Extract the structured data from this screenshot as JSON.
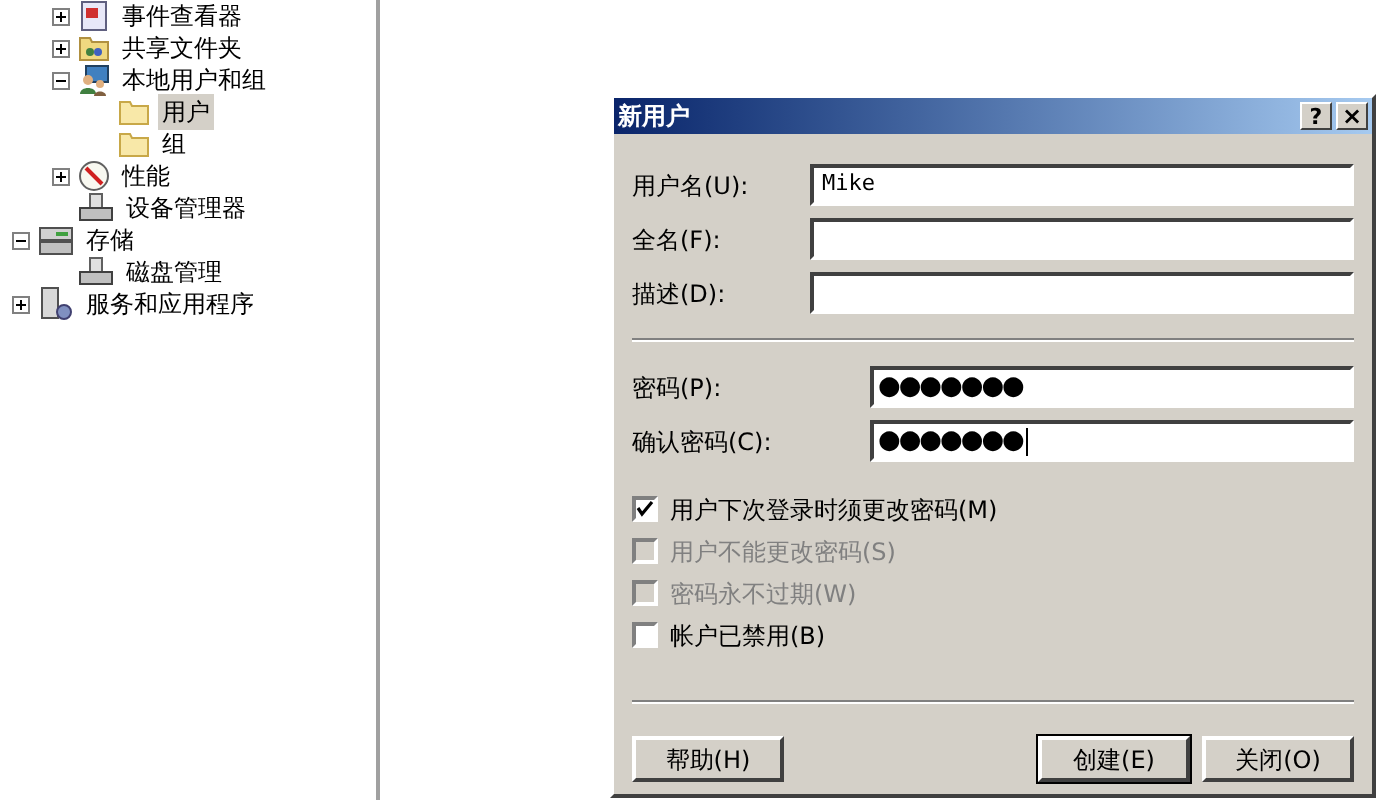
{
  "tree": [
    {
      "children": [
        {
          "label": "事件查看器",
          "expanded": false,
          "kind": "viewer"
        },
        {
          "label": "共享文件夹",
          "expanded": false,
          "kind": "share"
        },
        {
          "label": "本地用户和组",
          "expanded": true,
          "kind": "users",
          "children": [
            {
              "label": "用户",
              "kind": "folder",
              "selected": true
            },
            {
              "label": "组",
              "kind": "folder",
              "selected": false
            }
          ]
        },
        {
          "label": "性能",
          "expanded": false,
          "kind": "perf"
        },
        {
          "label": "设备管理器",
          "kind": "device"
        }
      ]
    },
    {
      "label": "存储",
      "expanded": true,
      "kind": "storage",
      "children": [
        {
          "label": "磁盘管理",
          "kind": "device"
        }
      ]
    },
    {
      "label": "服务和应用程序",
      "expanded": false,
      "kind": "services"
    }
  ],
  "dialog": {
    "title": "新用户",
    "help_glyph": "?",
    "close_glyph": "×",
    "fields": [
      {
        "label": "用户名(U):",
        "value": "Mike",
        "focused": false
      },
      {
        "label": "全名(F):",
        "focused": false
      },
      {
        "label": "描述(D):",
        "focused": false
      }
    ],
    "password_fields": [
      {
        "label": "密码(P):",
        "value": "●●●●●●●",
        "focused": false
      },
      {
        "label": "确认密码(C):",
        "value": "●●●●●●●",
        "focused": true
      }
    ],
    "checkboxes": [
      {
        "label": "用户下次登录时须更改密码(M)",
        "checked": true,
        "disabled": false
      },
      {
        "label": "用户不能更改密码(S)",
        "checked": false,
        "disabled": true
      },
      {
        "label": "密码永不过期(W)",
        "checked": false,
        "disabled": true
      },
      {
        "label": "帐户已禁用(B)",
        "checked": false,
        "disabled": false
      }
    ],
    "buttons": [
      {
        "label": "帮助(H)",
        "default": false
      },
      {
        "label": "创建(E)",
        "default": true
      },
      {
        "label": "关闭(O)",
        "default": false
      }
    ]
  }
}
